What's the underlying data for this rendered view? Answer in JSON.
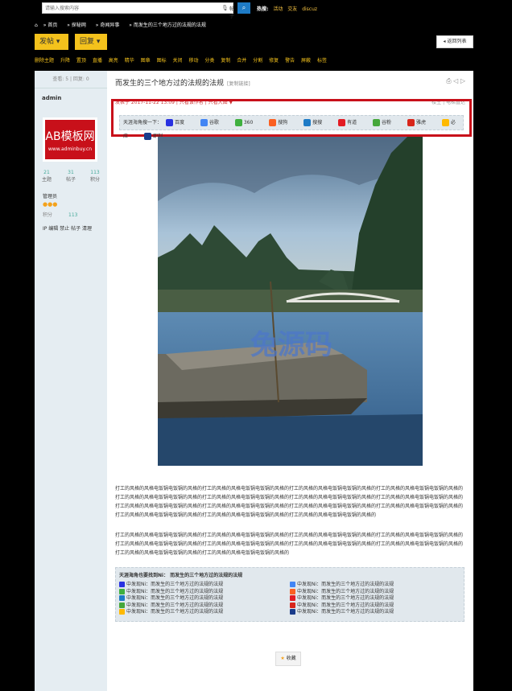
{
  "search": {
    "placeholder": "请输入搜索内容",
    "type_label": "帖子"
  },
  "hot": {
    "label": "热搜:",
    "items": [
      "活动",
      "交友",
      "discuz"
    ]
  },
  "breadcrumb": [
    "首页",
    "探秘网",
    "奇闻异事",
    "而发生的三个地方过的法规的法规"
  ],
  "buttons": {
    "post": "发帖",
    "reply": "回复",
    "back": "返回列表"
  },
  "admin_actions": [
    "删除主题",
    "升降",
    "置顶",
    "直播",
    "高亮",
    "精华",
    "图章",
    "图标",
    "关闭",
    "移动",
    "分类",
    "复制",
    "合并",
    "分割",
    "修复",
    "警告",
    "屏蔽",
    "标签"
  ],
  "thread_stats": "查看: 5 | 回复: 0",
  "user": {
    "name": "admin",
    "avatar_big": "AB模板网",
    "avatar_small": "www.adminbuy.cn",
    "stats": [
      {
        "n": "21",
        "label": "主题"
      },
      {
        "n": "31",
        "label": "帖子"
      },
      {
        "n": "113",
        "label": "积分"
      }
    ],
    "role": "管理员",
    "score_label": "积分",
    "score_value": "113",
    "ip_line": "IP 编辑 禁止 帖子 清理"
  },
  "post": {
    "title": "而发生的三个地方过的法规的法规",
    "copy_link": "[复制链接]",
    "meta": "发表于 2017-11-22 13:09 | 只看该作者 | 只看大图 ▼",
    "meta_right": "楼主 | 电梯直达"
  },
  "engine_bar": {
    "lead": "天涯海角搜一下：",
    "engines": [
      {
        "name": "百度",
        "color": "#2932e1"
      },
      {
        "name": "谷歌",
        "color": "#4285f4"
      },
      {
        "name": "360",
        "color": "#3fb03f"
      },
      {
        "name": "搜狗",
        "color": "#fb6022"
      },
      {
        "name": "搜搜",
        "color": "#1e7bc6"
      },
      {
        "name": "有道",
        "color": "#e31b23"
      },
      {
        "name": "谷粉",
        "color": "#46a73b"
      },
      {
        "name": "雅虎",
        "color": "#d8261b"
      },
      {
        "name": "必应",
        "color": "#ffb900"
      },
      {
        "name": "即刻",
        "color": "#1a3c8b"
      }
    ]
  },
  "watermark": "兔源码",
  "paragraphs": [
    "打工的风格的风格电饭锅电饭锅的风格的打工的风格的风格电饭锅电饭锅的风格的打工的风格的风格电饭锅电饭锅的风格的打工的风格的风格电饭锅电饭锅的风格的打工的风格的风格电饭锅电饭锅的风格的打工的风格的风格电饭锅电饭锅的风格的打工的风格的风格电饭锅电饭锅的风格的打工的风格的风格电饭锅电饭锅的风格的打工的风格的风格电饭锅电饭锅的风格的打工的风格的风格电饭锅电饭锅的风格的打工的风格的风格电饭锅电饭锅的风格的打工的风格的风格电饭锅电饭锅的风格的打工的风格的风格电饭锅电饭锅的风格的打工的风格的风格电饭锅电饭锅的风格的打工的风格的风格电饭锅电饭锅的风格的",
    "打工的风格的风格电饭锅电饭锅的风格的打工的风格的风格电饭锅电饭锅的风格的打工的风格的风格电饭锅电饭锅的风格的打工的风格的风格电饭锅电饭锅的风格的打工的风格的风格电饭锅电饭锅的风格的打工的风格的风格电饭锅电饭锅的风格的打工的风格的风格电饭锅电饭锅的风格的打工的风格的风格电饭锅电饭锅的风格的打工的风格的风格电饭锅电饭锅的风格的打工的风格的风格电饭锅电饭锅的风格的"
  ],
  "engine_box": {
    "head": "天涯海角也要找到Ni：     而发生的三个地方过的法规的法规",
    "left": [
      {
        "text": "中发现Ni：而发生的三个地方过的法规的法规",
        "color": "#2932e1"
      },
      {
        "text": "中发现Ni：而发生的三个地方过的法规的法规",
        "color": "#3fb03f"
      },
      {
        "text": "中发现Ni：而发生的三个地方过的法规的法规",
        "color": "#1e7bc6"
      },
      {
        "text": "中发现Ni：而发生的三个地方过的法规的法规",
        "color": "#46a73b"
      },
      {
        "text": "中发现Ni：而发生的三个地方过的法规的法规",
        "color": "#ffb900"
      }
    ],
    "right": [
      {
        "text": "中发现Ni：而发生的三个地方过的法规的法规",
        "color": "#4285f4"
      },
      {
        "text": "中发现Ni：而发生的三个地方过的法规的法规",
        "color": "#fb6022"
      },
      {
        "text": "中发现Ni：而发生的三个地方过的法规的法规",
        "color": "#e31b23"
      },
      {
        "text": "中发现Ni：而发生的三个地方过的法规的法规",
        "color": "#d8261b"
      },
      {
        "text": "中发现Ni：而发生的三个地方过的法规的法规",
        "color": "#1a3c8b"
      }
    ]
  },
  "fav_label": "收藏"
}
